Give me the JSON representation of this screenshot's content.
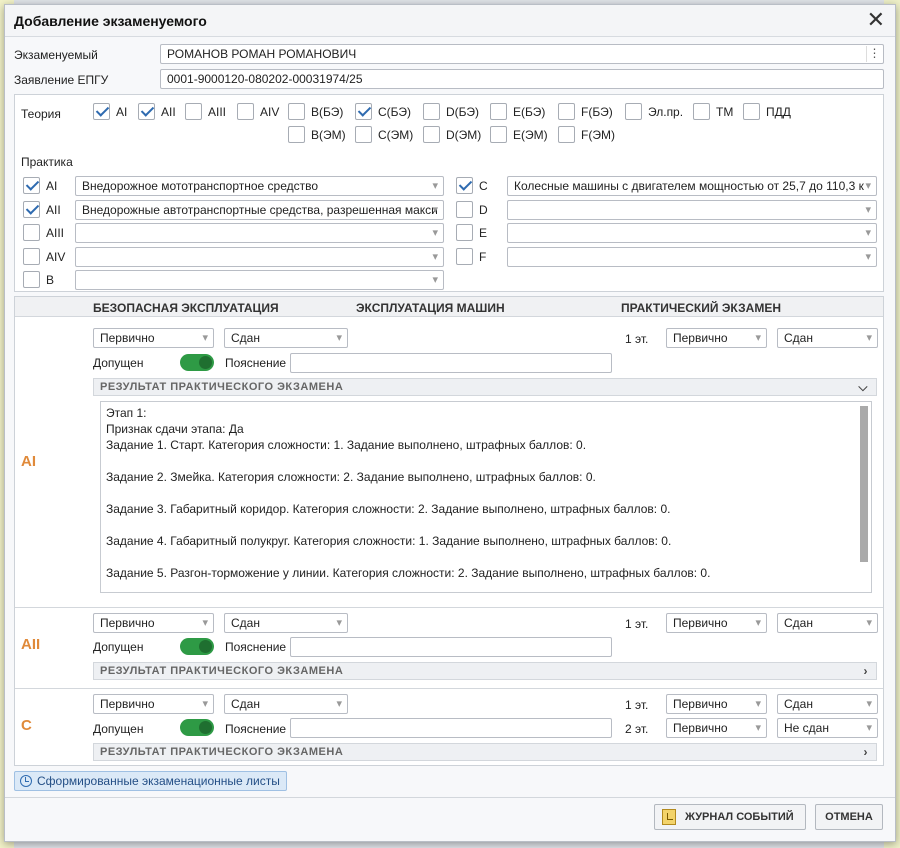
{
  "dialog": {
    "title": "Добавление экзаменуемого",
    "close_icon": "close-icon"
  },
  "examinee": {
    "label": "Экзаменуемый",
    "value": "РОМАНОВ РОМАН РОМАНОВИЧ",
    "application_label": "Заявление ЕПГУ",
    "application_value": "0001-9000120-080202-00031974/25"
  },
  "theory": {
    "label": "Теория",
    "items": [
      {
        "label": "AI",
        "checked": true
      },
      {
        "label": "AII",
        "checked": true
      },
      {
        "label": "AIII",
        "checked": false
      },
      {
        "label": "AIV",
        "checked": false
      },
      {
        "label": "B(БЭ)",
        "checked": false
      },
      {
        "label": "C(БЭ)",
        "checked": true
      },
      {
        "label": "D(БЭ)",
        "checked": false
      },
      {
        "label": "E(БЭ)",
        "checked": false
      },
      {
        "label": "F(БЭ)",
        "checked": false
      },
      {
        "label": "Эл.пр.",
        "checked": false
      },
      {
        "label": "ТМ",
        "checked": false
      },
      {
        "label": "ПДД",
        "checked": false
      },
      {
        "label": "B(ЭМ)",
        "checked": false
      },
      {
        "label": "C(ЭМ)",
        "checked": false
      },
      {
        "label": "D(ЭМ)",
        "checked": false
      },
      {
        "label": "E(ЭМ)",
        "checked": false
      },
      {
        "label": "F(ЭМ)",
        "checked": false
      }
    ]
  },
  "practice": {
    "label": "Практика",
    "left": [
      {
        "label": "AI",
        "checked": true,
        "value": "Внедорожное мототранспортное средство"
      },
      {
        "label": "AII",
        "checked": true,
        "value": "Внедорожные автотранспортные средства, разрешенная макси"
      },
      {
        "label": "AIII",
        "checked": false,
        "value": ""
      },
      {
        "label": "AIV",
        "checked": false,
        "value": ""
      },
      {
        "label": "B",
        "checked": false,
        "value": ""
      }
    ],
    "right": [
      {
        "label": "C",
        "checked": true,
        "value": "Колесные машины с двигателем мощностью от 25,7 до 110,3 к"
      },
      {
        "label": "D",
        "checked": false,
        "value": ""
      },
      {
        "label": "E",
        "checked": false,
        "value": ""
      },
      {
        "label": "F",
        "checked": false,
        "value": ""
      }
    ]
  },
  "exam_headers": {
    "safe": "БЕЗОПАСНАЯ ЭКСПЛУАТАЦИЯ",
    "machines": "ЭКСПЛУАТАЦИЯ МАШИН",
    "practical": "ПРАКТИЧЕСКИЙ ЭКЗАМЕН"
  },
  "categories": [
    {
      "name": "AI",
      "attempt": "Первично",
      "status": "Сдан",
      "admitted_label": "Допущен",
      "note_label": "Пояснение",
      "note_value": "",
      "stages": [
        {
          "label": "1 эт.",
          "attempt": "Первично",
          "status": "Сдан"
        }
      ],
      "result_label": "РЕЗУЛЬТАТ ПРАКТИЧЕСКОГО ЭКЗАМЕНА",
      "result_lines": [
        "Этап 1:",
        "Признак сдачи этапа: Да",
        "Задание 1. Старт. Категория сложности: 1. Задание выполнено, штрафных баллов: 0.",
        "",
        "Задание 2. Змейка. Категория сложности: 2. Задание выполнено, штрафных баллов: 0.",
        "",
        "Задание 3. Габаритный коридор. Категория сложности: 2. Задание выполнено, штрафных баллов: 0.",
        "",
        "Задание 4. Габаритный полукруг. Категория сложности: 1. Задание выполнено, штрафных баллов: 0.",
        "",
        "Задание 5. Разгон-торможение у линии. Категория сложности: 2. Задание выполнено, штрафных баллов: 0."
      ]
    },
    {
      "name": "AII",
      "attempt": "Первично",
      "status": "Сдан",
      "admitted_label": "Допущен",
      "note_label": "Пояснение",
      "note_value": "",
      "stages": [
        {
          "label": "1 эт.",
          "attempt": "Первично",
          "status": "Сдан"
        }
      ],
      "result_label": "РЕЗУЛЬТАТ ПРАКТИЧЕСКОГО ЭКЗАМЕНА"
    },
    {
      "name": "C",
      "attempt": "Первично",
      "status": "Сдан",
      "admitted_label": "Допущен",
      "note_label": "Пояснение",
      "note_value": "",
      "stages": [
        {
          "label": "1 эт.",
          "attempt": "Первично",
          "status": "Сдан"
        },
        {
          "label": "2 эт.",
          "attempt": "Первично",
          "status": "Не сдан"
        }
      ],
      "result_label": "РЕЗУЛЬТАТ ПРАКТИЧЕСКОГО ЭКЗАМЕНА"
    }
  ],
  "formed_sheets_label": "Сформированные экзаменационные листы",
  "footer": {
    "journal_label": "ЖУРНАЛ СОБЫТИЙ",
    "cancel_label": "ОТМЕНА"
  },
  "colors": {
    "category_label": "#e08a3a",
    "toggle_on": "#2e9a45",
    "checkbox_check": "#2f6bb0"
  }
}
